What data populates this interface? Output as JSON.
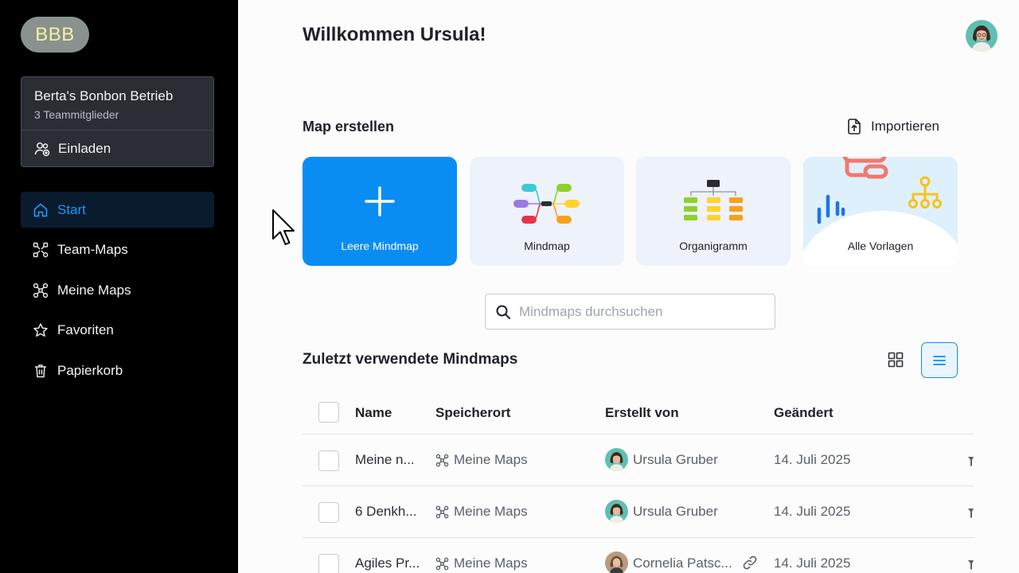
{
  "sidebar": {
    "logo": "BBB",
    "team": {
      "name": "Berta's Bonbon Betrieb",
      "members": "3 Teammitglieder",
      "invite_label": "Einladen"
    },
    "nav": [
      {
        "label": "Start",
        "icon": "home-icon",
        "active": true
      },
      {
        "label": "Team-Maps",
        "icon": "team-maps-icon"
      },
      {
        "label": "Meine Maps",
        "icon": "mindmap-icon"
      },
      {
        "label": "Favoriten",
        "icon": "star-icon"
      },
      {
        "label": "Papierkorb",
        "icon": "trash-icon"
      }
    ]
  },
  "header": {
    "welcome": "Willkommen Ursula!"
  },
  "create": {
    "title": "Map erstellen",
    "import_label": "Importieren",
    "cards": [
      {
        "label": "Leere Mindmap"
      },
      {
        "label": "Mindmap"
      },
      {
        "label": "Organigramm"
      },
      {
        "label": "Alle Vorlagen"
      }
    ]
  },
  "search": {
    "placeholder": "Mindmaps durchsuchen",
    "value": ""
  },
  "recent": {
    "title": "Zuletzt verwendete Mindmaps",
    "columns": {
      "name": "Name",
      "location": "Speicherort",
      "creator": "Erstellt von",
      "modified": "Geändert"
    },
    "rows": [
      {
        "name": "Meine n...",
        "location": "Meine Maps",
        "creator": "Ursula Gruber",
        "modified": "14. Juli 2025"
      },
      {
        "name": "6 Denkh...",
        "location": "Meine Maps",
        "creator": "Ursula Gruber",
        "modified": "14. Juli 2025"
      },
      {
        "name": "Agiles Pr...",
        "location": "Meine Maps",
        "creator": "Cornelia Patsc...",
        "modified": "14. Juli 2025"
      }
    ]
  },
  "colors": {
    "accent": "#0a8df2",
    "sidebar_bg": "#000000",
    "active_nav": "#1e97f2"
  }
}
